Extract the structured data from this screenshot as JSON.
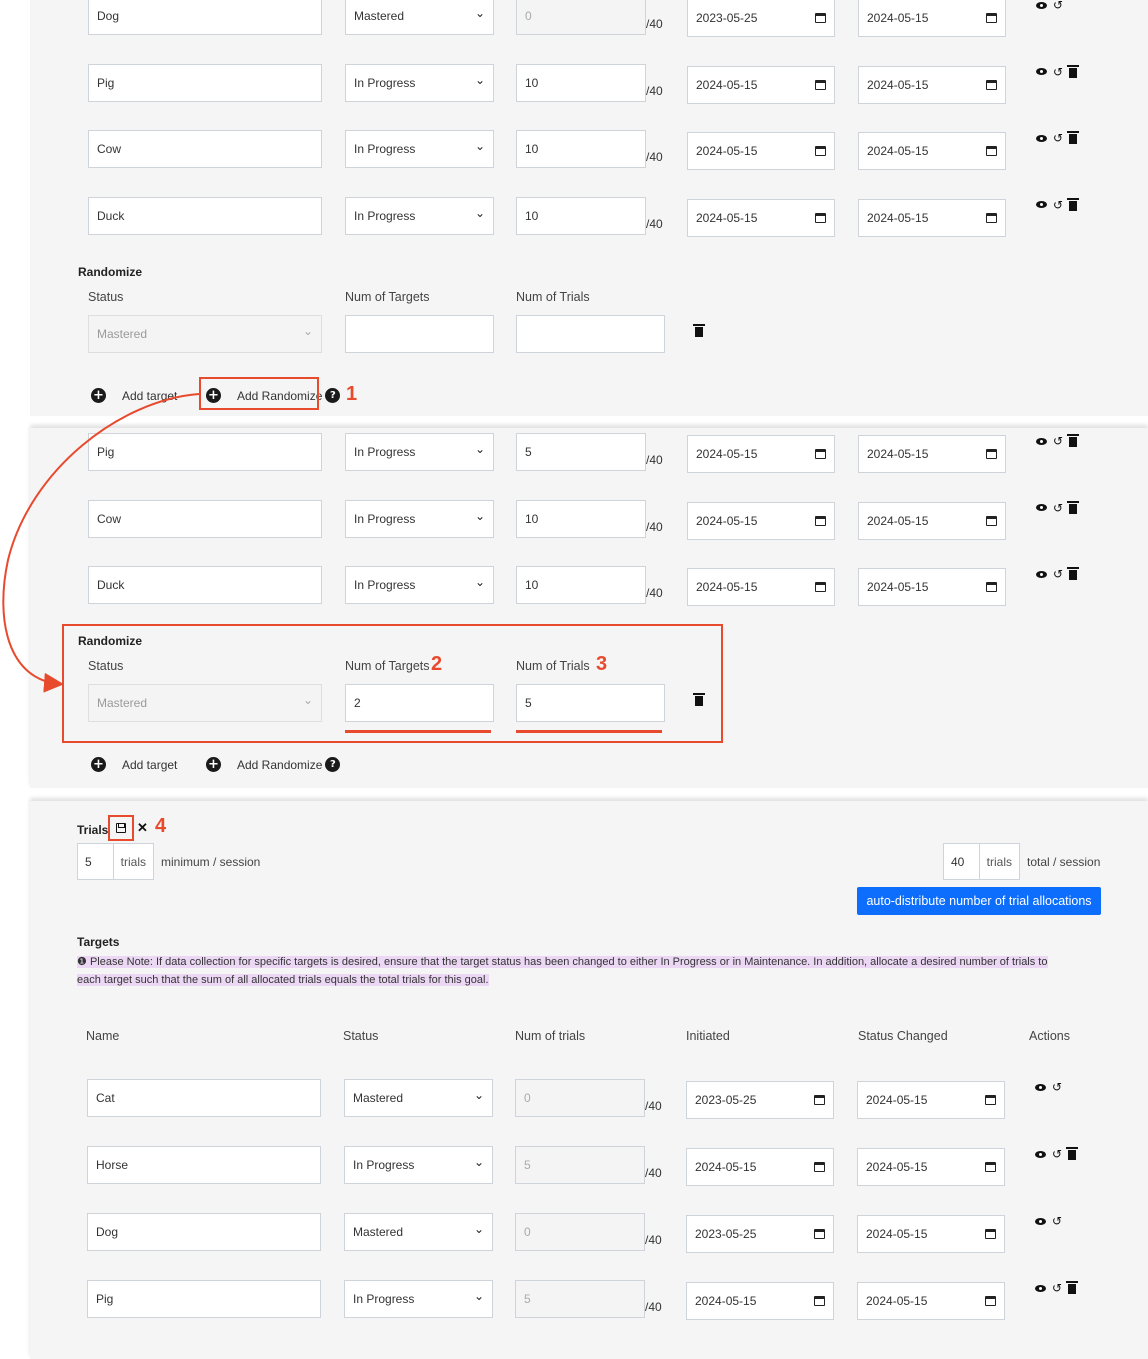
{
  "max_trials_suffix": "/40",
  "panel1": {
    "rows": [
      {
        "name": "Dog",
        "status": "Mastered",
        "trials": "0",
        "trials_disabled": true,
        "initiated": "2023-05-25",
        "changed": "2024-05-15",
        "has_delete": false
      },
      {
        "name": "Pig",
        "status": "In Progress",
        "trials": "10",
        "trials_disabled": false,
        "initiated": "2024-05-15",
        "changed": "2024-05-15",
        "has_delete": true
      },
      {
        "name": "Cow",
        "status": "In Progress",
        "trials": "10",
        "trials_disabled": false,
        "initiated": "2024-05-15",
        "changed": "2024-05-15",
        "has_delete": true
      },
      {
        "name": "Duck",
        "status": "In Progress",
        "trials": "10",
        "trials_disabled": false,
        "initiated": "2024-05-15",
        "changed": "2024-05-15",
        "has_delete": true
      }
    ],
    "randomize": {
      "heading": "Randomize",
      "status_label": "Status",
      "targets_label": "Num of Targets",
      "trials_label": "Num of Trials",
      "status_value": "Mastered",
      "targets_value": "",
      "trials_value": ""
    },
    "add_target": "Add target",
    "add_randomize": "Add Randomize"
  },
  "panel2": {
    "rows": [
      {
        "name": "Pig",
        "status": "In Progress",
        "trials": "5",
        "trials_disabled": false,
        "initiated": "2024-05-15",
        "changed": "2024-05-15",
        "has_delete": true
      },
      {
        "name": "Cow",
        "status": "In Progress",
        "trials": "10",
        "trials_disabled": false,
        "initiated": "2024-05-15",
        "changed": "2024-05-15",
        "has_delete": true
      },
      {
        "name": "Duck",
        "status": "In Progress",
        "trials": "10",
        "trials_disabled": false,
        "initiated": "2024-05-15",
        "changed": "2024-05-15",
        "has_delete": true
      }
    ],
    "randomize": {
      "heading": "Randomize",
      "status_label": "Status",
      "targets_label": "Num of Targets",
      "trials_label": "Num of Trials",
      "status_value": "Mastered",
      "targets_value": "2",
      "trials_value": "5"
    },
    "add_target": "Add target",
    "add_randomize": "Add Randomize"
  },
  "panel3": {
    "trials_heading": "Trials",
    "min_value": "5",
    "min_addon": "trials",
    "min_label": "minimum / session",
    "total_value": "40",
    "total_addon": "trials",
    "total_label": "total / session",
    "auto_button": "auto-distribute number of trial allocations",
    "targets_heading": "Targets",
    "note_icon": "❶",
    "note_text": "Please Note: If data collection for specific targets is desired, ensure that the target status has been changed to either In Progress or in Maintenance. In addition, allocate a desired number of trials to",
    "note_text2": "each target such that the sum of all allocated trials equals the total trials for this goal.",
    "headers": {
      "name": "Name",
      "status": "Status",
      "trials": "Num of trials",
      "initiated": "Initiated",
      "changed": "Status Changed",
      "actions": "Actions"
    },
    "rows": [
      {
        "name": "Cat",
        "status": "Mastered",
        "trials": "0",
        "trials_disabled": true,
        "initiated": "2023-05-25",
        "changed": "2024-05-15",
        "has_delete": false
      },
      {
        "name": "Horse",
        "status": "In Progress",
        "trials": "5",
        "trials_disabled": true,
        "initiated": "2024-05-15",
        "changed": "2024-05-15",
        "has_delete": true
      },
      {
        "name": "Dog",
        "status": "Mastered",
        "trials": "0",
        "trials_disabled": true,
        "initiated": "2023-05-25",
        "changed": "2024-05-15",
        "has_delete": false
      },
      {
        "name": "Pig",
        "status": "In Progress",
        "trials": "5",
        "trials_disabled": true,
        "initiated": "2024-05-15",
        "changed": "2024-05-15",
        "has_delete": true
      }
    ]
  },
  "annotations": {
    "n1": "1",
    "n2": "2",
    "n3": "3",
    "n4": "4"
  },
  "colors": {
    "accent": "#e84a2e",
    "button": "#0d6efd",
    "note_highlight": "#ecd8f5"
  }
}
